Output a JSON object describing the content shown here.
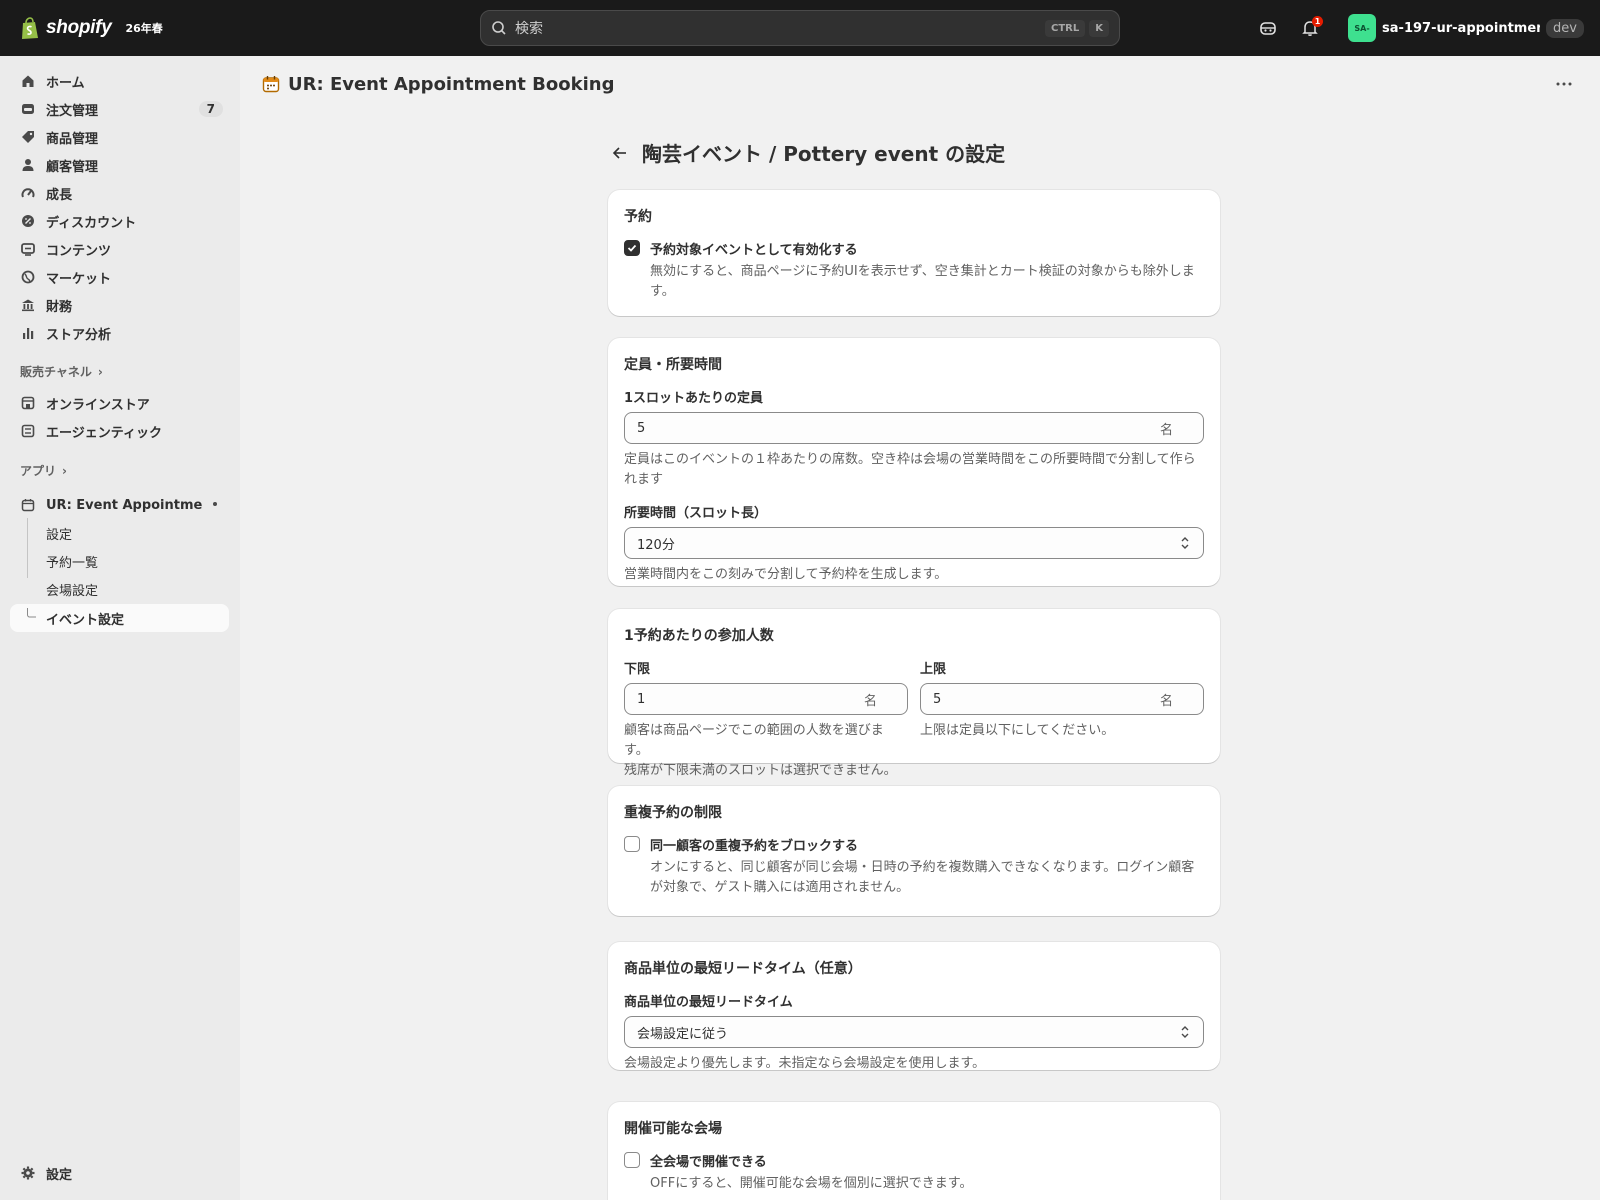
{
  "topbar": {
    "brand_name": "shopify",
    "brand_badge": "26年春",
    "search_placeholder": "検索",
    "shortcut_ctrl": "CTRL",
    "shortcut_k": "K",
    "notification_count": "1",
    "store_avatar": "SA-",
    "store_name": "sa-197-ur-appointment-a...",
    "env_badge": "dev"
  },
  "sidebar": {
    "items": [
      {
        "label": "ホーム",
        "icon": "home-icon"
      },
      {
        "label": "注文管理",
        "icon": "orders-icon",
        "count": "7"
      },
      {
        "label": "商品管理",
        "icon": "tag-icon"
      },
      {
        "label": "顧客管理",
        "icon": "person-icon"
      },
      {
        "label": "成長",
        "icon": "gauge-icon"
      },
      {
        "label": "ディスカウント",
        "icon": "discount-icon"
      },
      {
        "label": "コンテンツ",
        "icon": "content-icon"
      },
      {
        "label": "マーケット",
        "icon": "globe-icon"
      },
      {
        "label": "財務",
        "icon": "bank-icon"
      },
      {
        "label": "ストア分析",
        "icon": "chart-icon"
      }
    ],
    "sales_channels_heading": "販売チャネル",
    "channels": [
      {
        "label": "オンラインストア",
        "icon": "store-icon"
      },
      {
        "label": "エージェンティック",
        "icon": "agentic-icon"
      }
    ],
    "apps_heading": "アプリ",
    "app_name": "UR: Event Appointmen...",
    "app_subitems": [
      "設定",
      "予約一覧",
      "会場設定",
      "イベント設定"
    ],
    "settings_label": "設定"
  },
  "app_header": {
    "title": "UR: Event Appointment Booking"
  },
  "page": {
    "title": "陶芸イベント / Pottery event の設定"
  },
  "cards": {
    "booking": {
      "title": "予約",
      "checkbox_label": "予約対象イベントとして有効化する",
      "checked": true,
      "help_line1": "無効にすると、商品ページに予約UIを表示せず、空き集計とカート検証の対象からも除外しま",
      "help_line2": "す。"
    },
    "capacity": {
      "title": "定員・所要時間",
      "capacity_label": "1スロットあたりの定員",
      "capacity_value": "5",
      "capacity_suffix": "名",
      "capacity_help_line1": "定員はこのイベントの１枠あたりの席数。空き枠は会場の営業時間をこの所要時間で分割して作ら",
      "capacity_help_line2": "れます",
      "duration_label": "所要時間（スロット長）",
      "duration_value": "120分",
      "duration_help": "営業時間内をこの刻みで分割して予約枠を生成します。"
    },
    "party_size": {
      "title": "1予約あたりの参加人数",
      "min_label": "下限",
      "min_value": "1",
      "min_suffix": "名",
      "min_help_line1": "顧客は商品ページでこの範囲の人数を選びます。",
      "min_help_line2": "残席が下限未満のスロットは選択できません。",
      "max_label": "上限",
      "max_value": "5",
      "max_suffix": "名",
      "max_help": "上限は定員以下にしてください。"
    },
    "duplicate": {
      "title": "重複予約の制限",
      "checkbox_label": "同一顧客の重複予約をブロックする",
      "checked": false,
      "help_line1": "オンにすると、同じ顧客が同じ会場・日時の予約を複数購入できなくなります。ログイン顧客",
      "help_line2": "が対象で、ゲスト購入には適用されません。"
    },
    "lead_time": {
      "title": "商品単位の最短リードタイム（任意）",
      "field_label": "商品単位の最短リードタイム",
      "select_value": "会場設定に従う",
      "help": "会場設定より優先します。未指定なら会場設定を使用します。"
    },
    "venues": {
      "title": "開催可能な会場",
      "checkbox_label": "全会場で開催できる",
      "checked": false,
      "help": "OFFにすると、開催可能な会場を個別に選択できます。"
    }
  },
  "colors": {
    "topbar_bg": "#1a1a1a",
    "sidebar_bg": "#ebebeb",
    "page_bg": "#f1f1f1",
    "card_bg": "#ffffff",
    "accent_green": "#3ee08f",
    "notification_red": "#e51c00"
  }
}
